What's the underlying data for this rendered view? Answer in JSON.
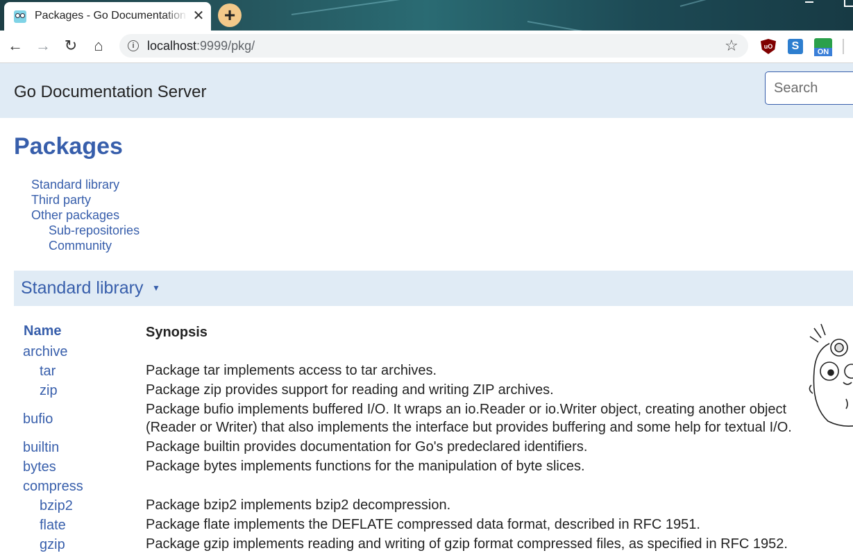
{
  "browser": {
    "tab_title": "Packages - Go Documentation Server",
    "close_glyph": "✕",
    "newtab_glyph": "+",
    "url_host": "localhost",
    "url_rest": ":9999/pkg/",
    "info_glyph": "i",
    "star_glyph": "☆",
    "back_glyph": "←",
    "forward_glyph": "→",
    "reload_glyph": "↻",
    "home_glyph": "⌂",
    "ext_ublock": "uO",
    "ext_s": "S",
    "ext_on": "ON"
  },
  "header": {
    "title": "Go Documentation Server",
    "search_placeholder": "Search"
  },
  "page": {
    "heading": "Packages",
    "toc": [
      {
        "label": "Standard library",
        "sub": false
      },
      {
        "label": "Third party",
        "sub": false
      },
      {
        "label": "Other packages",
        "sub": false
      },
      {
        "label": "Sub-repositories",
        "sub": true
      },
      {
        "label": "Community",
        "sub": true
      }
    ],
    "section_title": "Standard library",
    "section_arrow": "▼"
  },
  "table": {
    "col_name": "Name",
    "col_synopsis": "Synopsis",
    "rows": [
      {
        "name": "archive",
        "indent": false,
        "synopsis": ""
      },
      {
        "name": "tar",
        "indent": true,
        "synopsis": "Package tar implements access to tar archives."
      },
      {
        "name": "zip",
        "indent": true,
        "synopsis": "Package zip provides support for reading and writing ZIP archives."
      },
      {
        "name": "bufio",
        "indent": false,
        "synopsis": "Package bufio implements buffered I/O. It wraps an io.Reader or io.Writer object, creating another object (Reader or Writer) that also implements the interface but provides buffering and some help for textual I/O."
      },
      {
        "name": "builtin",
        "indent": false,
        "synopsis": "Package builtin provides documentation for Go's predeclared identifiers."
      },
      {
        "name": "bytes",
        "indent": false,
        "synopsis": "Package bytes implements functions for the manipulation of byte slices."
      },
      {
        "name": "compress",
        "indent": false,
        "synopsis": ""
      },
      {
        "name": "bzip2",
        "indent": true,
        "synopsis": "Package bzip2 implements bzip2 decompression."
      },
      {
        "name": "flate",
        "indent": true,
        "synopsis": "Package flate implements the DEFLATE compressed data format, described in RFC 1951."
      },
      {
        "name": "gzip",
        "indent": true,
        "synopsis": "Package gzip implements reading and writing of gzip format compressed files, as specified in RFC 1952."
      }
    ]
  },
  "colors": {
    "link": "#375eab",
    "header_bg": "#e0ebf5"
  }
}
